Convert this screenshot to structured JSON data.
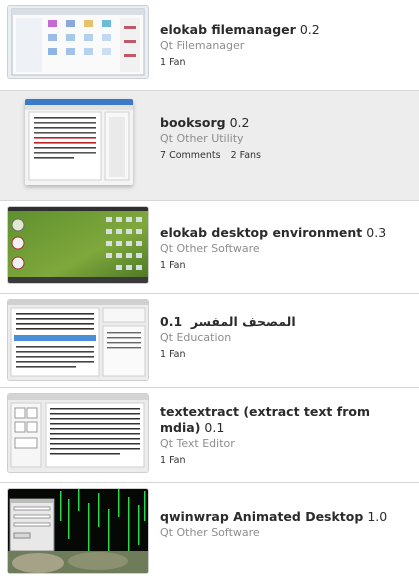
{
  "items": [
    {
      "name": "elokab filemanager",
      "version": "0.2",
      "category": "Qt Filemanager",
      "stats": [
        "1 Fan"
      ]
    },
    {
      "name": "booksorg",
      "version": "0.2",
      "category": "Qt Other Utility",
      "stats": [
        "7 Comments",
        "2 Fans"
      ]
    },
    {
      "name": "elokab desktop environment",
      "version": "0.3",
      "category": "Qt Other Software",
      "stats": [
        "1 Fan"
      ]
    },
    {
      "name": "المصحف المفسر",
      "version": "0.1",
      "category": "Qt Education",
      "stats": [
        "1 Fan"
      ]
    },
    {
      "name": "textextract (extract text from mdia)",
      "version": "0.1",
      "category": "Qt Text Editor",
      "stats": [
        "1 Fan"
      ]
    },
    {
      "name": "qwinwrap Animated Desktop",
      "version": "1.0",
      "category": "Qt Other Software",
      "stats": []
    }
  ],
  "colors": {
    "title": "#2b2b2b",
    "category": "#8d8d8d",
    "highlight_row": "#ededed",
    "divider": "#d6d6d6"
  }
}
